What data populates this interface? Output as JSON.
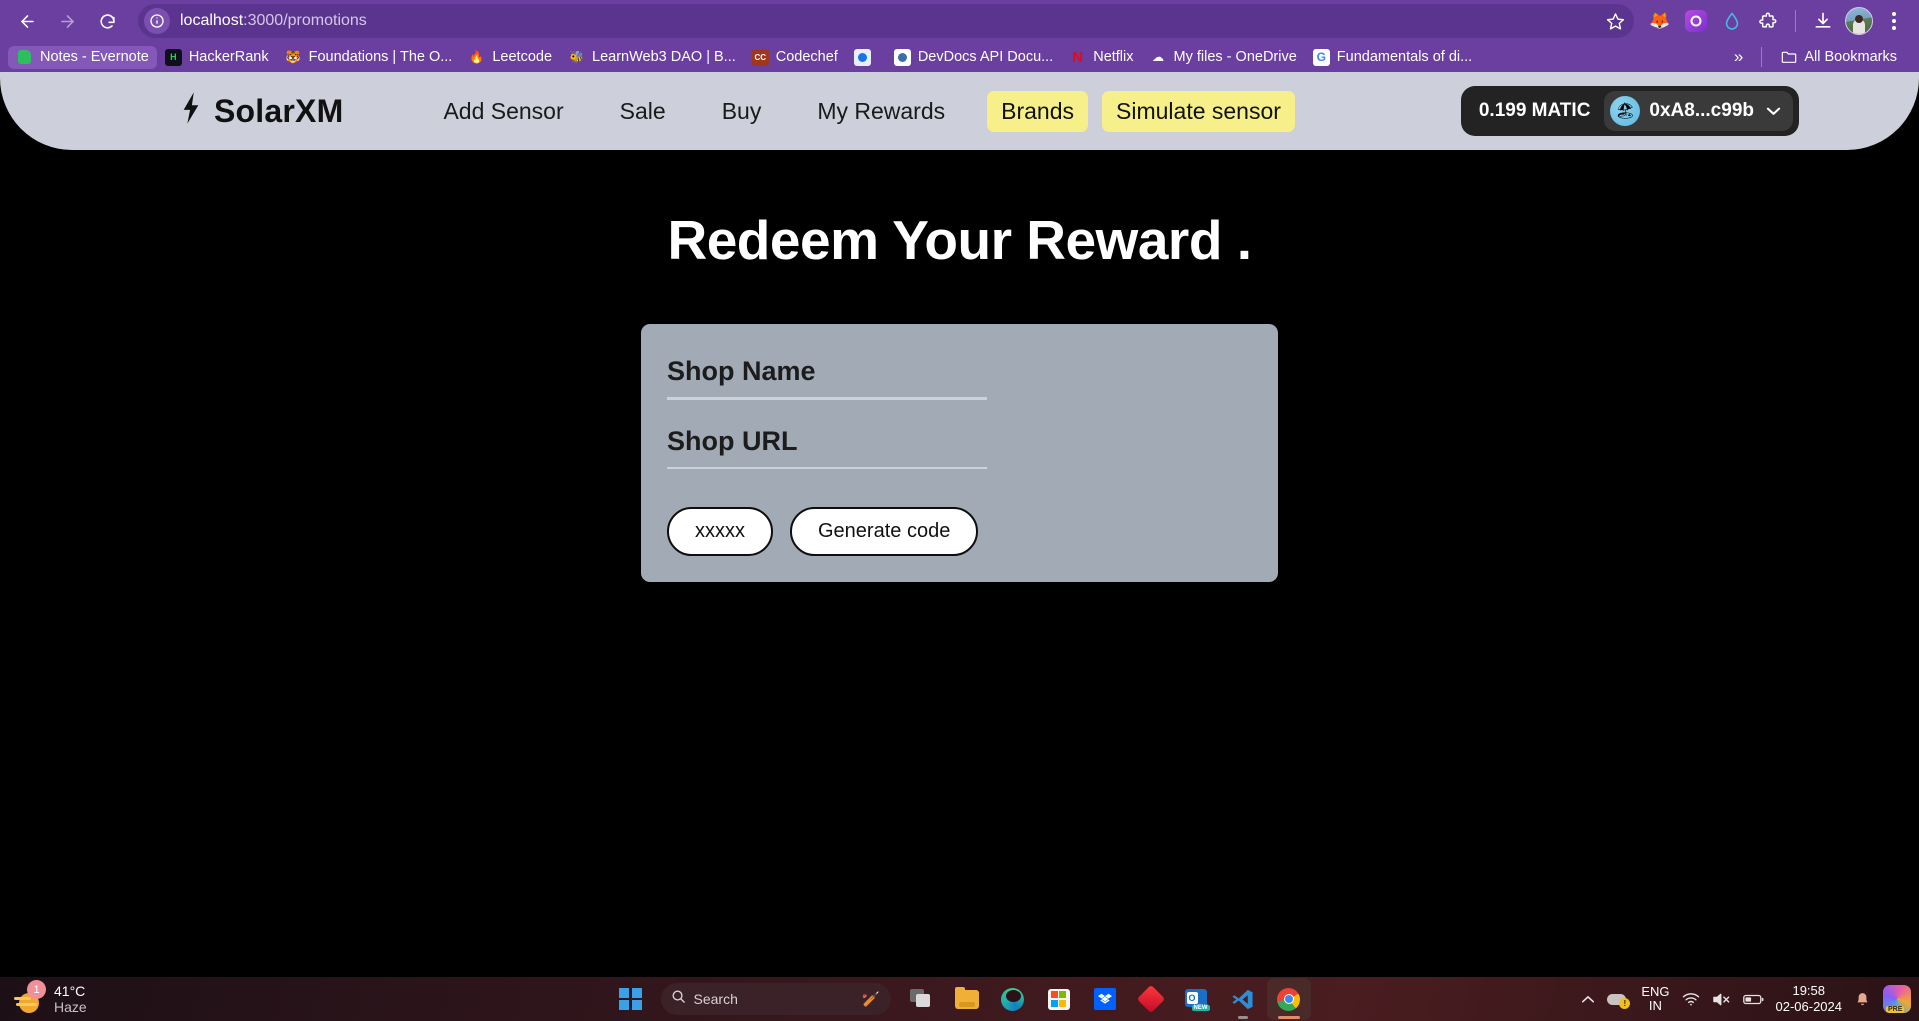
{
  "browser": {
    "back_label": "Back",
    "forward_label": "Forward",
    "reload_label": "Reload",
    "url_host": "localhost",
    "url_path": ":3000/promotions",
    "site_info_icon": "info-circle-icon",
    "bookmark_star_icon": "star-icon",
    "extensions": [
      {
        "name": "metamask-extension-icon",
        "glyph": "🦊"
      },
      {
        "name": "phantom-wallet-extension-icon",
        "glyph": "◉"
      },
      {
        "name": "rainbow-wallet-extension-icon",
        "glyph": "💧"
      },
      {
        "name": "extensions-puzzle-icon",
        "glyph": "🧩"
      }
    ],
    "download_icon": "download-icon",
    "profile_icon": "profile-avatar",
    "menu_icon": "three-dot-menu-icon"
  },
  "bookmarks": {
    "items": [
      {
        "label": "Notes - Evernote",
        "icon": "evernote-icon",
        "active": true
      },
      {
        "label": "HackerRank",
        "icon": "hackerrank-icon",
        "active": false
      },
      {
        "label": "Foundations | The O...",
        "icon": "odin-project-icon",
        "active": false
      },
      {
        "label": "Leetcode",
        "icon": "leetcode-icon",
        "active": false
      },
      {
        "label": "LearnWeb3 DAO | B...",
        "icon": "learnweb3-icon",
        "active": false
      },
      {
        "label": "Codechef",
        "icon": "codechef-icon",
        "active": false
      },
      {
        "label": "",
        "icon": "photos-icon",
        "active": false
      },
      {
        "label": "DevDocs API Docu...",
        "icon": "devdocs-icon",
        "active": false
      },
      {
        "label": "Netflix",
        "icon": "netflix-icon",
        "active": false
      },
      {
        "label": "My files - OneDrive",
        "icon": "onedrive-icon",
        "active": false
      },
      {
        "label": "Fundamentals of di...",
        "icon": "google-icon",
        "active": false
      }
    ],
    "overflow_label": "»",
    "all_bookmarks_label": "All Bookmarks",
    "all_bookmarks_icon": "folder-icon"
  },
  "app": {
    "brand": {
      "name": "SolarXM",
      "icon": "lightning-bolt-icon",
      "glyph": "⚡"
    },
    "nav": [
      {
        "label": "Add Sensor",
        "style": "link"
      },
      {
        "label": "Sale",
        "style": "link"
      },
      {
        "label": "Buy",
        "style": "link"
      },
      {
        "label": "My Rewards",
        "style": "link"
      },
      {
        "label": "Brands",
        "style": "pill"
      },
      {
        "label": "Simulate sensor",
        "style": "pill"
      }
    ],
    "wallet": {
      "balance": "0.199 MATIC",
      "address": "0xA8...c99b",
      "avatar_icon": "beach-umbrella-avatar",
      "avatar_glyph": "🏖",
      "chevron": "⌄"
    },
    "colors": {
      "navbar_bg": "#cdd0da",
      "pill_bg": "#f7ef8a",
      "page_bg": "#000000",
      "card_bg": "#a2aab6",
      "wallet_bg": "#232323",
      "browser_bg": "#6b3fa0"
    }
  },
  "main": {
    "title": "Redeem Your Reward .",
    "form": {
      "fields": [
        {
          "label": "Shop Name",
          "value": "",
          "name": "shop-name-input"
        },
        {
          "label": "Shop URL",
          "value": "",
          "name": "shop-url-input"
        }
      ],
      "buttons": [
        {
          "label": "xxxxx",
          "name": "xxxxx-button"
        },
        {
          "label": "Generate code",
          "name": "generate-code-button"
        }
      ]
    }
  },
  "taskbar": {
    "weather": {
      "temperature": "41°C",
      "condition": "Haze",
      "badge": "1",
      "icon": "haze-weather-icon"
    },
    "start_icon": "windows-start-icon",
    "search": {
      "placeholder": "Search",
      "icon": "search-icon",
      "illustration": "cricket-icon",
      "glyph": "🏏"
    },
    "apps": [
      {
        "name": "task-view-icon",
        "state": "idle"
      },
      {
        "name": "file-explorer-icon",
        "state": "idle"
      },
      {
        "name": "microsoft-edge-icon",
        "state": "idle"
      },
      {
        "name": "microsoft-store-icon",
        "state": "idle"
      },
      {
        "name": "dropbox-icon",
        "state": "idle"
      },
      {
        "name": "red-diamond-app-icon",
        "state": "idle"
      },
      {
        "name": "outlook-new-icon",
        "state": "idle"
      },
      {
        "name": "vscode-icon",
        "state": "running"
      },
      {
        "name": "google-chrome-icon",
        "state": "active"
      }
    ],
    "tray": {
      "show_hidden_icon": "chevron-up-icon",
      "onedrive_icon": "onedrive-warning-icon",
      "language_line1": "ENG",
      "language_line2": "IN",
      "wifi_icon": "wifi-icon",
      "volume_icon": "volume-muted-icon",
      "battery_icon": "battery-icon",
      "time": "19:58",
      "date": "02-06-2024",
      "notification_icon": "bell-icon",
      "copilot_icon": "copilot-icon",
      "copilot_badge": "PRE"
    }
  }
}
